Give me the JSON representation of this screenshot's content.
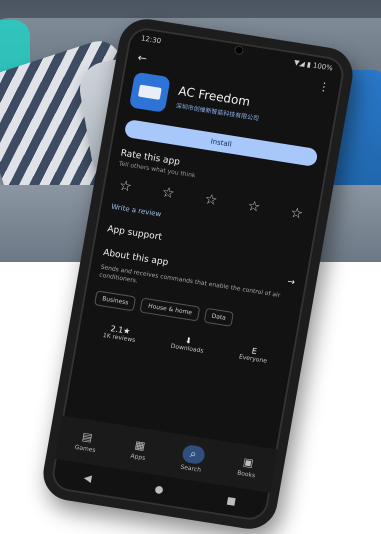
{
  "status": {
    "time": "12:30",
    "indicators": "▼◢ ▮ 100%"
  },
  "app": {
    "name": "AC Freedom",
    "developer": "深圳市创维新智能科技有限公司",
    "install_label": "Install"
  },
  "rate": {
    "title": "Rate this app",
    "subtitle": "Tell others what you think",
    "stars": [
      "☆",
      "☆",
      "☆",
      "☆",
      "☆"
    ],
    "write_review": "Write a review"
  },
  "sections": {
    "app_support": "App support",
    "about": "About this app",
    "about_desc": "Sends and receives commands that enable the control of air conditioners.",
    "arrow": "→"
  },
  "chips": [
    "Business",
    "House & home",
    "Data"
  ],
  "info": [
    {
      "big": "2.1★",
      "small": "1K reviews"
    },
    {
      "big": "⬇",
      "small": "Downloads"
    },
    {
      "big": "E",
      "small": "Everyone"
    }
  ],
  "nav": [
    {
      "icon": "▤",
      "label": "Games"
    },
    {
      "icon": "▦",
      "label": "Apps"
    },
    {
      "icon": "⌕",
      "label": "Search",
      "active": true
    },
    {
      "icon": "▣",
      "label": "Books"
    }
  ],
  "sysnav": {
    "back": "◀",
    "home": "●",
    "recents": "■"
  },
  "colors": {
    "install": "#a8c7fa",
    "icon_bg": "#2e73d6",
    "blue_pillow": "#2a78c8"
  }
}
